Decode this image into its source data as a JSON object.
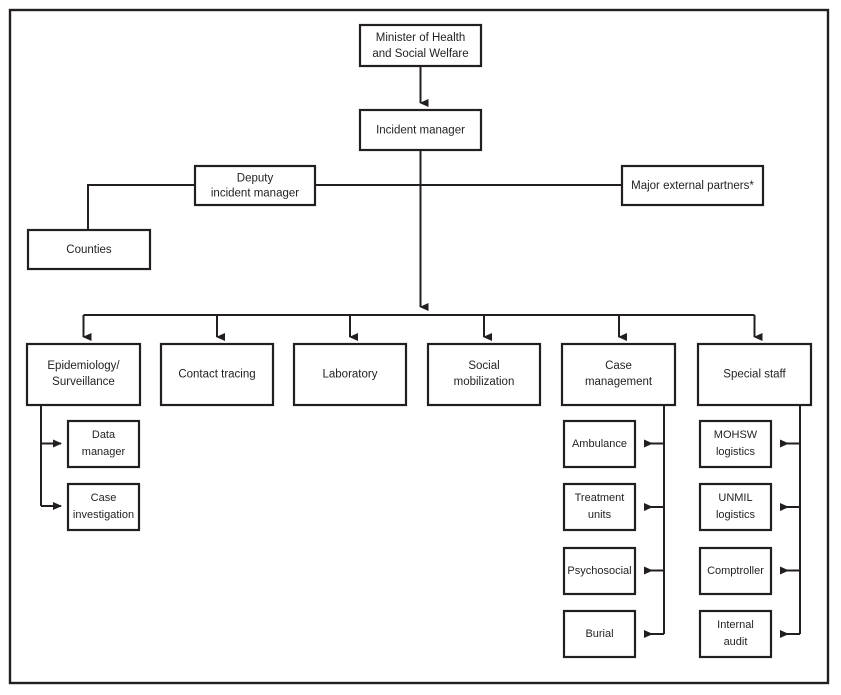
{
  "figure": {
    "type": "organizational-chart",
    "title": "",
    "footnote_marker": "*"
  },
  "nodes": {
    "minister": {
      "label_line1": "Minister of Health",
      "label_line2": "and Social Welfare"
    },
    "incident_manager": {
      "label_line1": "Incident manager",
      "label_line2": ""
    },
    "deputy_incident_manager": {
      "label_line1": "Deputy",
      "label_line2": "incident manager"
    },
    "major_external_partners": {
      "label_line1": "Major external partners*",
      "label_line2": ""
    },
    "counties": {
      "label_line1": "Counties",
      "label_line2": ""
    },
    "epidemiology": {
      "label_line1": "Epidemiology/",
      "label_line2": "Surveillance"
    },
    "contact_tracing": {
      "label_line1": "Contact tracing",
      "label_line2": ""
    },
    "laboratory": {
      "label_line1": "Laboratory",
      "label_line2": ""
    },
    "social_mobilization": {
      "label_line1": "Social",
      "label_line2": "mobilization"
    },
    "case_management": {
      "label_line1": "Case",
      "label_line2": "management"
    },
    "special_staff": {
      "label_line1": "Special staff",
      "label_line2": ""
    },
    "data_manager": {
      "label_line1": "Data",
      "label_line2": "manager"
    },
    "case_investigation": {
      "label_line1": "Case",
      "label_line2": "investigation"
    },
    "ambulance": {
      "label_line1": "Ambulance",
      "label_line2": ""
    },
    "treatment_units": {
      "label_line1": "Treatment",
      "label_line2": "units"
    },
    "psychosocial": {
      "label_line1": "Psychosocial",
      "label_line2": ""
    },
    "burial": {
      "label_line1": "Burial",
      "label_line2": ""
    },
    "mohsw_logistics": {
      "label_line1": "MOHSW",
      "label_line2": "logistics"
    },
    "unmil_logistics": {
      "label_line1": "UNMIL",
      "label_line2": "logistics"
    },
    "comptroller": {
      "label_line1": "Comptroller",
      "label_line2": ""
    },
    "internal_audit": {
      "label_line1": "Internal",
      "label_line2": "audit"
    }
  },
  "colors": {
    "stroke": "#231f20",
    "fill": "#ffffff",
    "text": "#231f20"
  }
}
